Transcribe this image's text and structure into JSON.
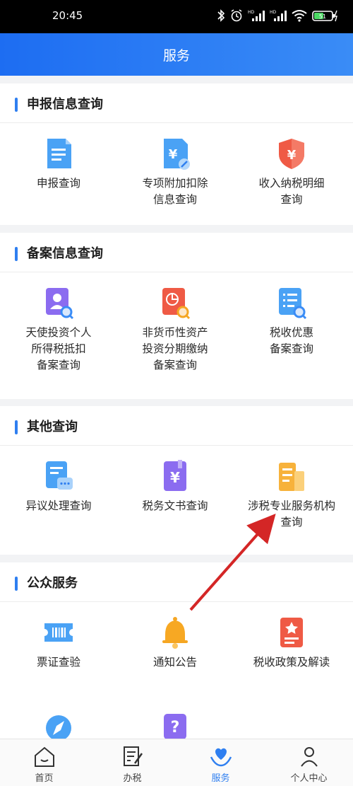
{
  "status_bar": {
    "time": "20:45",
    "icons": [
      "bluetooth-icon",
      "alarm-icon",
      "signal-hd-icon",
      "signal-hd-icon",
      "wifi-icon",
      "battery-icon"
    ],
    "battery_level": "51"
  },
  "header": {
    "title": "服务"
  },
  "sections": [
    {
      "title": "申报信息查询",
      "items": [
        {
          "lines": [
            "申报查询"
          ],
          "icon": "declaration-doc-icon"
        },
        {
          "lines": [
            "专项附加扣除",
            "信息查询"
          ],
          "icon": "deduction-yen-doc-icon"
        },
        {
          "lines": [
            "收入纳税明细",
            "查询"
          ],
          "icon": "yen-shield-icon"
        }
      ]
    },
    {
      "title": "备案信息查询",
      "items": [
        {
          "lines": [
            "天使投资个人",
            "所得税抵扣",
            "备案查询"
          ],
          "icon": "person-search-icon"
        },
        {
          "lines": [
            "非货币性资产",
            "投资分期缴纳",
            "备案查询"
          ],
          "icon": "chart-search-icon"
        },
        {
          "lines": [
            "税收优惠",
            "备案查询"
          ],
          "icon": "list-search-icon"
        }
      ]
    },
    {
      "title": "其他查询",
      "items": [
        {
          "lines": [
            "异议处理查询"
          ],
          "icon": "objection-chat-icon"
        },
        {
          "lines": [
            "税务文书查询"
          ],
          "icon": "tax-document-icon"
        },
        {
          "lines": [
            "涉税专业服务机构",
            "查询"
          ],
          "icon": "agency-building-icon"
        }
      ]
    },
    {
      "title": "公众服务",
      "items": [
        {
          "lines": [
            "票证查验"
          ],
          "icon": "ticket-barcode-icon"
        },
        {
          "lines": [
            "通知公告"
          ],
          "icon": "bell-icon"
        },
        {
          "lines": [
            "税收政策及解读"
          ],
          "icon": "policy-star-icon"
        },
        {
          "lines": [],
          "icon": "compass-icon"
        },
        {
          "lines": [],
          "icon": "question-icon"
        }
      ]
    }
  ],
  "tabs": [
    {
      "label": "首页",
      "icon": "home-icon",
      "active": false
    },
    {
      "label": "办税",
      "icon": "edit-doc-icon",
      "active": false
    },
    {
      "label": "服务",
      "icon": "heart-hands-icon",
      "active": true
    },
    {
      "label": "个人中心",
      "icon": "person-icon",
      "active": false
    }
  ],
  "colors": {
    "brand_blue": "#2f7ff0",
    "header_gradient": [
      "#1d6df2",
      "#3a8cf6"
    ],
    "annotation_arrow": "#d42626"
  }
}
